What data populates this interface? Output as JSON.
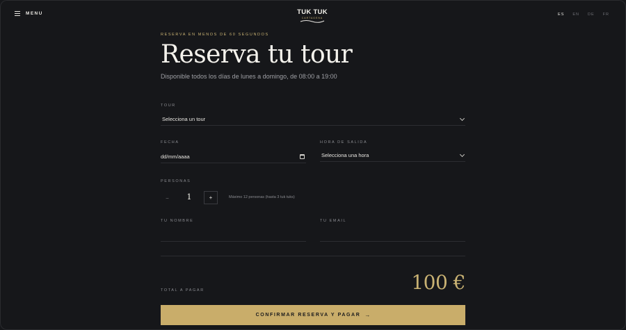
{
  "header": {
    "menu_label": "MENU",
    "logo_title": "TUK TUK",
    "logo_subtitle": "CARTAGENA",
    "languages": [
      "ES",
      "EN",
      "DE",
      "FR"
    ],
    "active_language": "ES"
  },
  "hero": {
    "eyebrow": "RESERVA EN MENOS DE 60 SEGUNDOS",
    "title": "Reserva tu tour",
    "subtitle": "Disponible todos los días de lunes a domingo, de 08:00 a 19:00"
  },
  "form": {
    "tour_label": "TOUR",
    "tour_value": "Selecciona un tour",
    "date_label": "FECHA",
    "date_placeholder": "dd/mm/aaaa",
    "time_label": "HORA DE SALIDA",
    "time_value": "Selecciona una hora",
    "people_label": "PERSONAS",
    "people_minus": "−",
    "people_value": "1",
    "people_plus": "+",
    "people_note": "Máximo 12 personas (hasta 3 tuk tuks)",
    "name_label": "TU NOMBRE",
    "name_value": "",
    "email_label": "TU EMAIL",
    "email_value": ""
  },
  "summary": {
    "total_label": "TOTAL A PAGAR",
    "total_amount": "100 €",
    "cta_label": "CONFIRMAR RESERVA Y PAGAR",
    "cta_arrow": "→"
  },
  "colors": {
    "background": "#16171a",
    "accent_gold": "#c9ad6a",
    "text": "#e8e6e1",
    "muted": "#8a8b90"
  },
  "icons": {
    "menu": "hamburger-icon",
    "select": "chevron-down-icon",
    "date": "calendar-icon",
    "cta": "arrow-right-icon"
  }
}
